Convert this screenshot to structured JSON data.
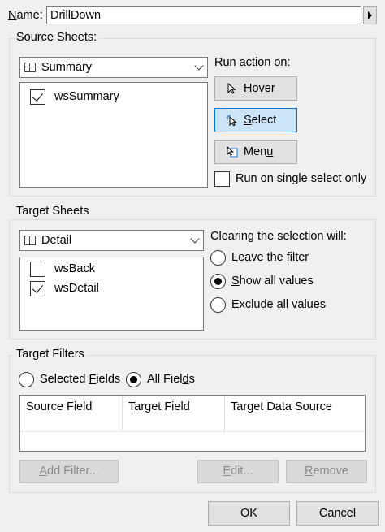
{
  "name_row": {
    "label": "Name:",
    "value": "DrillDown"
  },
  "source_sheets": {
    "title": "Source Sheets:",
    "combo_value": "Summary",
    "items": [
      {
        "label": "wsSummary",
        "checked": true
      }
    ]
  },
  "run_action": {
    "label": "Run action on:",
    "hover": "Hover",
    "select": "Select",
    "menu": "Menu",
    "single_select": "Run on single select only"
  },
  "target_sheets": {
    "title": "Target Sheets",
    "combo_value": "Detail",
    "items": [
      {
        "label": "wsBack",
        "checked": false
      },
      {
        "label": "wsDetail",
        "checked": true
      }
    ]
  },
  "clearing": {
    "label": "Clearing the selection will:",
    "options": [
      "Leave the filter",
      "Show all values",
      "Exclude all values"
    ],
    "selected": "Show all values"
  },
  "target_filters": {
    "title": "Target Filters",
    "selected_fields": "Selected Fields",
    "all_fields": "All Fields",
    "columns": [
      "Source Field",
      "Target Field",
      "Target Data Source"
    ],
    "add_filter": "Add Filter...",
    "edit": "Edit...",
    "remove": "Remove"
  },
  "footer": {
    "ok": "OK",
    "cancel": "Cancel"
  }
}
